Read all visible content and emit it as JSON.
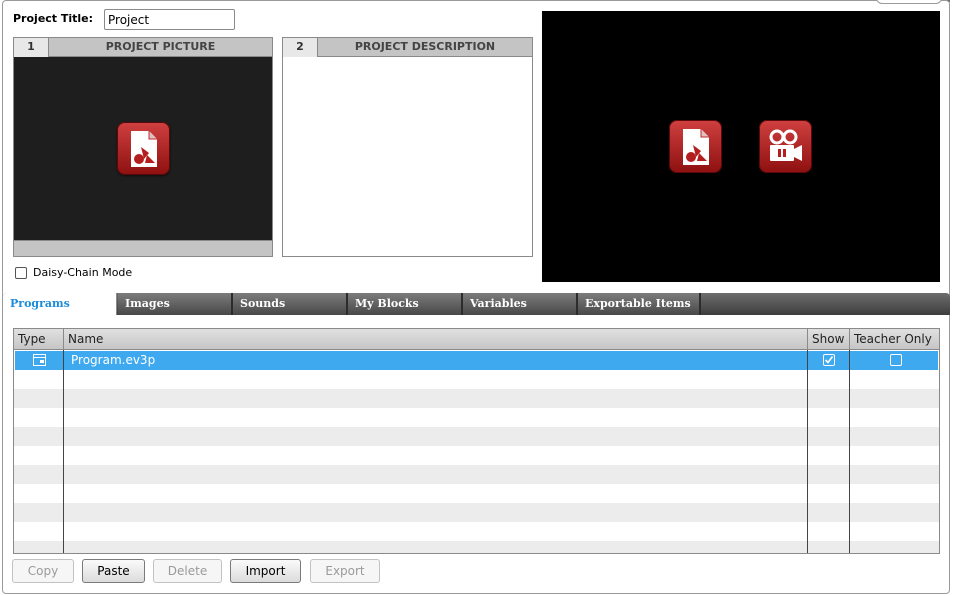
{
  "project": {
    "title_label": "Project Title:",
    "title_value": "Project"
  },
  "panels": {
    "picture": {
      "number": "1",
      "title": "PROJECT PICTURE"
    },
    "description": {
      "number": "2",
      "title": "PROJECT DESCRIPTION"
    }
  },
  "daisy_chain": {
    "label": "Daisy-Chain Mode",
    "checked": false
  },
  "icons": {
    "picture": "image-file-icon",
    "video": "video-camera-icon"
  },
  "tabs": [
    {
      "label": "Programs",
      "active": true
    },
    {
      "label": "Images",
      "active": false
    },
    {
      "label": "Sounds",
      "active": false
    },
    {
      "label": "My Blocks",
      "active": false
    },
    {
      "label": "Variables",
      "active": false
    },
    {
      "label": "Exportable Items",
      "active": false
    }
  ],
  "table": {
    "columns": [
      "Type",
      "Name",
      "Show",
      "Teacher Only"
    ],
    "rows": [
      {
        "type_icon": "program-icon",
        "name": "Program.ev3p",
        "show": true,
        "teacher_only": false
      }
    ]
  },
  "buttons": {
    "copy": "Copy",
    "paste": "Paste",
    "delete": "Delete",
    "import": "Import",
    "export": "Export"
  },
  "colors": {
    "selection": "#3fa9f0",
    "active_tab_text": "#1e8cd8",
    "icon_red": "#c02a2a"
  }
}
